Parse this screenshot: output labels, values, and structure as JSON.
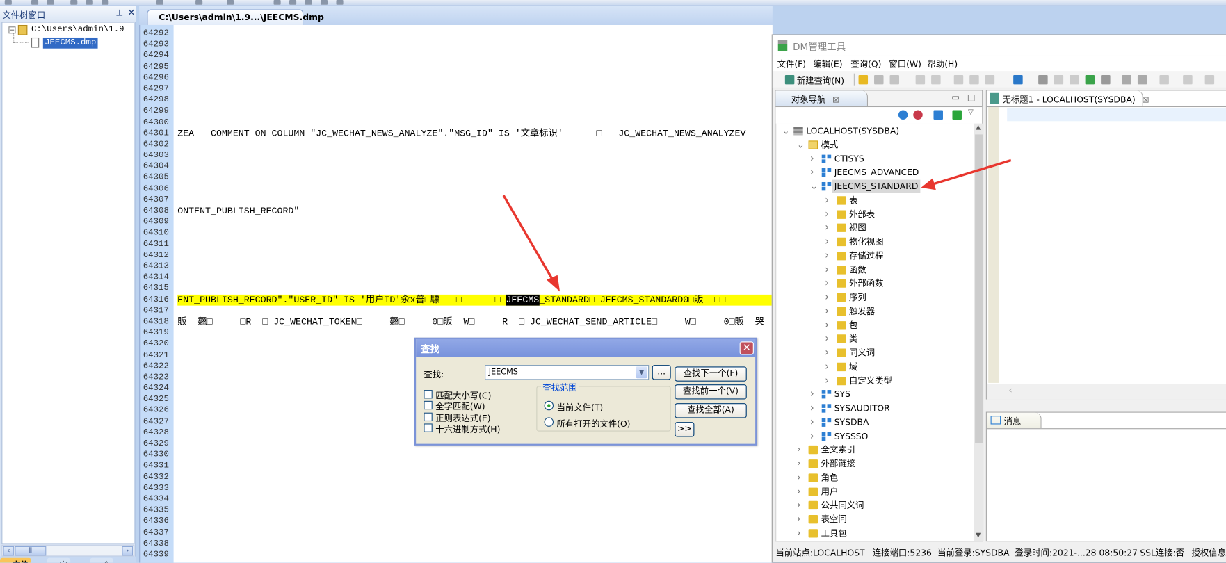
{
  "file_tree_window": {
    "title": "文件树窗口",
    "root_path": "C:\\Users\\admin\\1.9",
    "file": "JEECMS.dmp",
    "bottom_tabs": [
      "文件",
      "定",
      "变"
    ]
  },
  "editor": {
    "tab_title": "C:\\Users\\admin\\1.9...\\JEECMS.dmp",
    "line_numbers": [
      "64292",
      "64293",
      "64294",
      "64295",
      "64296",
      "64297",
      "64298",
      "64299",
      "64300",
      "64301",
      "64302",
      "64303",
      "64304",
      "64305",
      "64306",
      "64307",
      "64308",
      "64309",
      "64310",
      "64311",
      "64312",
      "64313",
      "64314",
      "64315",
      "64316",
      "64317",
      "64318",
      "64319",
      "64320",
      "64321",
      "64322",
      "64323",
      "64324",
      "64325",
      "64326",
      "64327",
      "64328",
      "64329",
      "64330",
      "64331",
      "64332",
      "64333",
      "64334",
      "64335",
      "64336",
      "64337",
      "64338",
      "64339"
    ],
    "line_64301": "ZEA   COMMENT ON COLUMN \"JC_WECHAT_NEWS_ANALYZE\".\"MSG_ID\" IS '文章标识'      □   JC_WECHAT_NEWS_ANALYZEV",
    "line_64308": "ONTENT_PUBLISH_RECORD\"",
    "line_64316_before": "ENT_PUBLISH_RECORD\".\"USER_ID\" IS '用户ID'汆x普□驃   □      □ ",
    "line_64316_match": "JEECMS",
    "line_64316_after": "_STANDARD□ JEECMS_STANDARD0□販  □□",
    "line_64318": "販  翹□     □R  □ JC_WECHAT_TOKEN□     翹□     0□販  W□     R  □ JC_WECHAT_SEND_ARTICLE□     W□     0□販  哭"
  },
  "find_dialog": {
    "title": "查找",
    "find_label": "查找:",
    "find_value": "JEECMS",
    "more_button": "...",
    "find_next": "查找下一个(F)",
    "find_prev": "查找前一个(V)",
    "find_all": "查找全部(A)",
    "expand": ">>",
    "options": [
      "匹配大小写(C)",
      "全字匹配(W)",
      "正则表达式(E)",
      "十六进制方式(H)"
    ],
    "scope_label": "查找范围",
    "scope_current": "当前文件(T)",
    "scope_all": "所有打开的文件(O)",
    "scope_selected": "current"
  },
  "dm_tool": {
    "title": "DM管理工具",
    "menu": [
      "文件(F)",
      "编辑(E)",
      "查询(Q)",
      "窗口(W)",
      "帮助(H)"
    ],
    "new_query": "新建查询(N)",
    "nav_tab": "对象导航",
    "sql_tab": "无标题1 - LOCALHOST(SYSDBA)",
    "messages_tab": "消息",
    "tree": [
      {
        "level": 0,
        "icon": "server",
        "exp": "v",
        "label": "LOCALHOST(SYSDBA)"
      },
      {
        "level": 1,
        "icon": "folder-open",
        "exp": "v",
        "label": "模式"
      },
      {
        "level": 2,
        "icon": "schema",
        "exp": ">",
        "label": "CTISYS"
      },
      {
        "level": 2,
        "icon": "schema",
        "exp": ">",
        "label": "JEECMS_ADVANCED"
      },
      {
        "level": 2,
        "icon": "schema",
        "exp": "v",
        "label": "JEECMS_STANDARD",
        "selected": true
      },
      {
        "level": 3,
        "icon": "folder",
        "exp": ">",
        "label": "表"
      },
      {
        "level": 3,
        "icon": "folder",
        "exp": ">",
        "label": "外部表"
      },
      {
        "level": 3,
        "icon": "folder",
        "exp": ">",
        "label": "视图"
      },
      {
        "level": 3,
        "icon": "folder",
        "exp": ">",
        "label": "物化视图"
      },
      {
        "level": 3,
        "icon": "folder",
        "exp": ">",
        "label": "存储过程"
      },
      {
        "level": 3,
        "icon": "folder",
        "exp": ">",
        "label": "函数"
      },
      {
        "level": 3,
        "icon": "folder",
        "exp": ">",
        "label": "外部函数"
      },
      {
        "level": 3,
        "icon": "folder",
        "exp": ">",
        "label": "序列"
      },
      {
        "level": 3,
        "icon": "folder",
        "exp": ">",
        "label": "触发器"
      },
      {
        "level": 3,
        "icon": "folder",
        "exp": ">",
        "label": "包"
      },
      {
        "level": 3,
        "icon": "folder",
        "exp": ">",
        "label": "类"
      },
      {
        "level": 3,
        "icon": "folder",
        "exp": ">",
        "label": "同义词"
      },
      {
        "level": 3,
        "icon": "folder",
        "exp": ">",
        "label": "域"
      },
      {
        "level": 3,
        "icon": "folder",
        "exp": ">",
        "label": "自定义类型"
      },
      {
        "level": 2,
        "icon": "schema",
        "exp": ">",
        "label": "SYS"
      },
      {
        "level": 2,
        "icon": "schema",
        "exp": ">",
        "label": "SYSAUDITOR"
      },
      {
        "level": 2,
        "icon": "schema",
        "exp": ">",
        "label": "SYSDBA"
      },
      {
        "level": 2,
        "icon": "schema",
        "exp": ">",
        "label": "SYSSSO"
      },
      {
        "level": 1,
        "icon": "folder",
        "exp": ">",
        "label": "全文索引"
      },
      {
        "level": 1,
        "icon": "folder",
        "exp": ">",
        "label": "外部链接"
      },
      {
        "level": 1,
        "icon": "folder",
        "exp": ">",
        "label": "角色"
      },
      {
        "level": 1,
        "icon": "folder",
        "exp": ">",
        "label": "用户"
      },
      {
        "level": 1,
        "icon": "folder",
        "exp": ">",
        "label": "公共同义词"
      },
      {
        "level": 1,
        "icon": "folder",
        "exp": ">",
        "label": "表空间"
      },
      {
        "level": 1,
        "icon": "folder",
        "exp": ">",
        "label": "工具包"
      }
    ],
    "status": {
      "site": "当前站点:LOCALHOST",
      "port": "连接端口:5236",
      "login": "当前登录:SYSDBA",
      "time": "登录时间:2021-...28 08:50:27",
      "ssl": "SSL连接:否",
      "license": "授权信息:"
    }
  },
  "colors": {
    "highlight": "#ffff00",
    "arrow": "#e8372f",
    "selection": "#316ac5"
  }
}
